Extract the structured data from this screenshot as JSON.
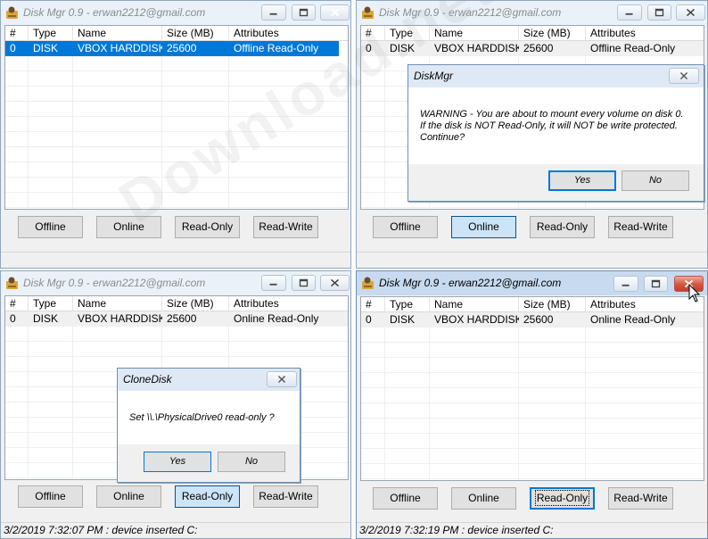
{
  "columns": [
    "#",
    "Type",
    "Name",
    "Size (MB)",
    "Attributes"
  ],
  "buttons": {
    "offline": "Offline",
    "online": "Online",
    "readonly": "Read-Only",
    "readwrite": "Read-Write"
  },
  "windows": [
    {
      "title": "Disk Mgr 0.9 - erwan2212@gmail.com",
      "row": {
        "num": "0",
        "type": "DISK",
        "name": "VBOX HARDDISK",
        "size": "25600",
        "attributes": "Offline Read-Only"
      },
      "status": ""
    },
    {
      "title": "Disk Mgr 0.9 - erwan2212@gmail.com",
      "row": {
        "num": "0",
        "type": "DISK",
        "name": "VBOX HARDDISK",
        "size": "25600",
        "attributes": "Offline Read-Only"
      },
      "status": ""
    },
    {
      "title": "Disk Mgr 0.9 - erwan2212@gmail.com",
      "row": {
        "num": "0",
        "type": "DISK",
        "name": "VBOX HARDDISK",
        "size": "25600",
        "attributes": "Online Read-Only"
      },
      "status": "3/2/2019 7:32:07 PM : device inserted C:"
    },
    {
      "title": "Disk Mgr 0.9 - erwan2212@gmail.com",
      "row": {
        "num": "0",
        "type": "DISK",
        "name": "VBOX HARDDISK",
        "size": "25600",
        "attributes": "Online Read-Only"
      },
      "status": "3/2/2019 7:32:19 PM : device inserted C:"
    }
  ],
  "dialog_diskmgr": {
    "title": "DiskMgr",
    "line1": "WARNING - You are about to mount every volume on disk 0.",
    "line2": "If the disk is NOT Read-Only, it will NOT be write protected.",
    "line3": "Continue?",
    "yes": "Yes",
    "no": "No"
  },
  "dialog_clonedisk": {
    "title": "CloneDisk",
    "message": "Set \\\\.\\PhysicalDrive0 read-only ?",
    "yes": "Yes",
    "no": "No"
  },
  "watermark": "Download.net",
  "colors": {
    "selection": "#0078d7",
    "close_red": "#c0412f"
  },
  "icons": [
    "disk-manager-app-icon",
    "minimize-icon",
    "maximize-icon",
    "close-icon",
    "mouse-cursor-icon"
  ]
}
